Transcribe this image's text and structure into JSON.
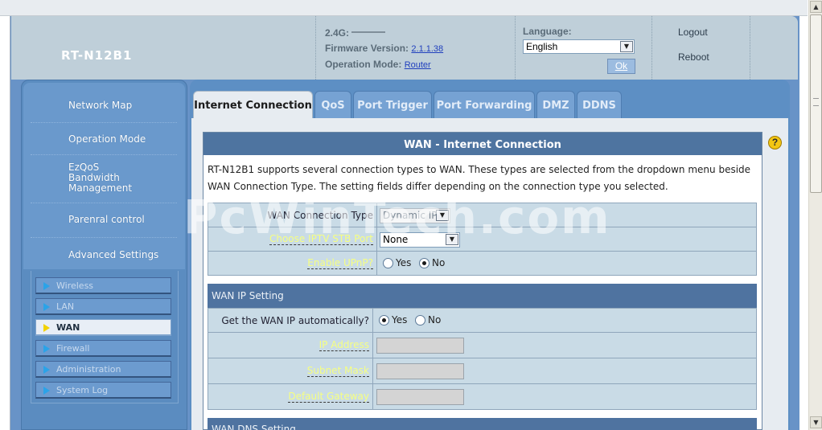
{
  "header": {
    "model": "RT-N12B1",
    "band_label": "2.4G:",
    "firmware_label": "Firmware Version:",
    "firmware_value": "2.1.1.38",
    "opmode_label": "Operation Mode:",
    "opmode_value": "Router",
    "language_label": "Language:",
    "language_value": "English",
    "ok_label": "Ok",
    "logout_label": "Logout",
    "reboot_label": "Reboot"
  },
  "sidebar": {
    "menu": [
      "Network Map",
      "Operation Mode",
      "EzQoS Bandwidth Management",
      "Parenral control",
      "Advanced Settings"
    ],
    "submenu": [
      "Wireless",
      "LAN",
      "WAN",
      "Firewall",
      "Administration",
      "System Log"
    ],
    "active_submenu": "WAN"
  },
  "tabs": [
    "Internet Connection",
    "QoS",
    "Port Trigger",
    "Port Forwarding",
    "DMZ",
    "DDNS"
  ],
  "active_tab": "Internet Connection",
  "form": {
    "title": "WAN - Internet Connection",
    "description": "RT-N12B1 supports several connection types to WAN. These types are selected from the dropdown menu beside WAN Connection Type. The setting fields differ depending on the connection type you selected.",
    "wan_connection_type_label": "WAN Connection Type",
    "wan_connection_type_value": "Dynamic IP",
    "iptv_label": "Choose IPTV STB Port",
    "iptv_value": "None",
    "upnp_label": "Enable UPnP?",
    "yes_label": "Yes",
    "no_label": "No",
    "upnp_selected": "No",
    "wan_ip_section": "WAN IP Setting",
    "auto_ip_label": "Get the WAN IP automatically?",
    "auto_ip_selected": "Yes",
    "ip_address_label": "IP Address",
    "ip_address_value": "",
    "subnet_mask_label": "Subnet Mask",
    "subnet_mask_value": "",
    "gateway_label": "Default Gateway",
    "gateway_value": "",
    "wan_dns_section": "WAN DNS Setting"
  },
  "watermark": "PcWinTech.com",
  "help_icon": "question-icon"
}
